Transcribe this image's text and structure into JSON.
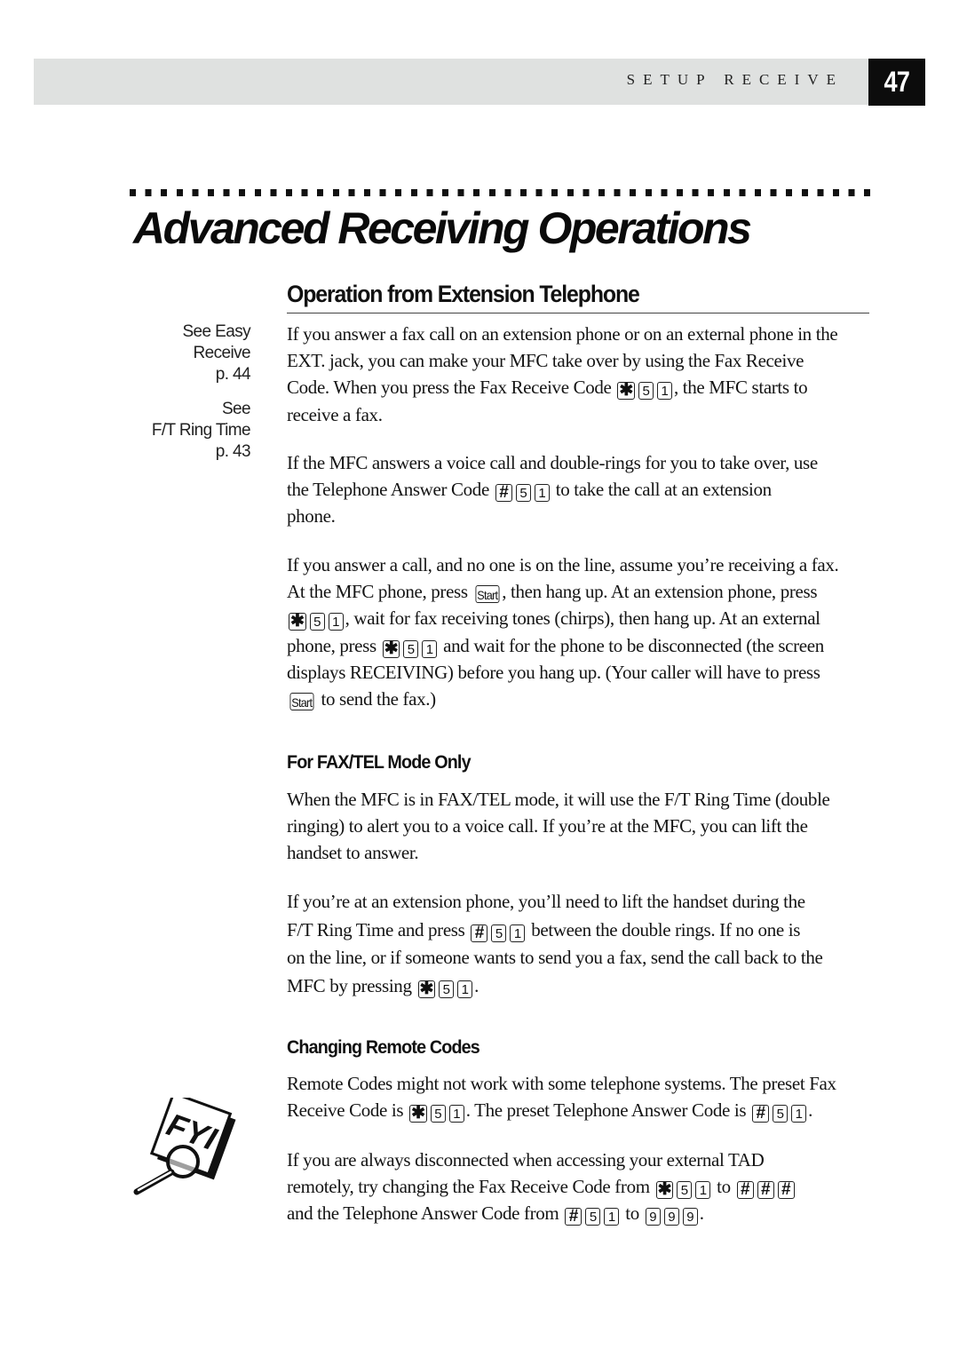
{
  "header": {
    "section_label": "SETUP RECEIVE",
    "page_number": "47"
  },
  "chapter_title": "Advanced Receiving Operations",
  "section_title": "Operation from Extension Telephone",
  "side_notes": [
    {
      "lines": [
        "See Easy",
        "Receive",
        "p. 44"
      ]
    },
    {
      "lines": [
        "See",
        "F/T Ring Time",
        "p. 43"
      ]
    }
  ],
  "keys": {
    "star": "✱",
    "hash": "#",
    "five": "5",
    "one": "1",
    "nine": "9",
    "start": "Start"
  },
  "paragraphs": {
    "p1": {
      "l1": "If you answer a fax call on an extension phone or on an external phone in the",
      "l2": "EXT. jack, you can make your MFC take over by using the Fax Receive",
      "l3a": "Code. When you press the Fax Receive Code",
      "l3b": ", the MFC starts to",
      "l4": "receive a fax."
    },
    "p2": {
      "l1": "If the MFC answers a voice call and double-rings for you to take over, use",
      "l2a": "the Telephone Answer Code",
      "l2b": "to take the call at an extension",
      "l3": "phone."
    },
    "p3": {
      "l1": "If you answer a call, and no one is on the line, assume you’re receiving a fax.",
      "l2a": "At the MFC phone, press",
      "l2b": ", then hang up. At an extension phone, press",
      "l3b": ", wait for fax receiving tones (chirps), then hang up.  At an external",
      "l4a": "phone, press",
      "l4b": "and wait for the phone to be disconnected (the screen",
      "l5": "displays RECEIVING) before you hang up. (Your caller will have to press",
      "l6b": "to send the fax.)"
    },
    "fax_tel_title": "For FAX/TEL Mode Only",
    "p4": {
      "l1": "When the MFC is in FAX/TEL mode, it will use the F/T Ring Time (double",
      "l2": "ringing) to alert you to a voice call. If you’re at the MFC, you can lift the",
      "l3": "handset to answer."
    },
    "p5": {
      "l1": "If you’re at an extension phone, you’ll need to lift the handset during the",
      "l2a": "F/T Ring Time and press",
      "l2b": "between the double rings. If no one is",
      "l3": "on the line, or if someone wants to send you a fax, send the call back to the",
      "l4a": "MFC by pressing",
      "l4b": "."
    },
    "remote_title": "Changing Remote Codes",
    "p6": {
      "l1": "Remote Codes might not work with some telephone systems. The preset Fax",
      "l2a": "Receive Code is",
      "l2b": ". The preset Telephone Answer Code is",
      "l2c": "."
    },
    "p7": {
      "l1": "If you are always disconnected when accessing your external TAD",
      "l2a": "remotely, try changing the Fax Receive Code from",
      "l2b": "to",
      "l3a": "and the Telephone Answer Code from",
      "l3b": "to",
      "l3c": "."
    }
  },
  "fyi_icon": {
    "label": "FYI"
  }
}
